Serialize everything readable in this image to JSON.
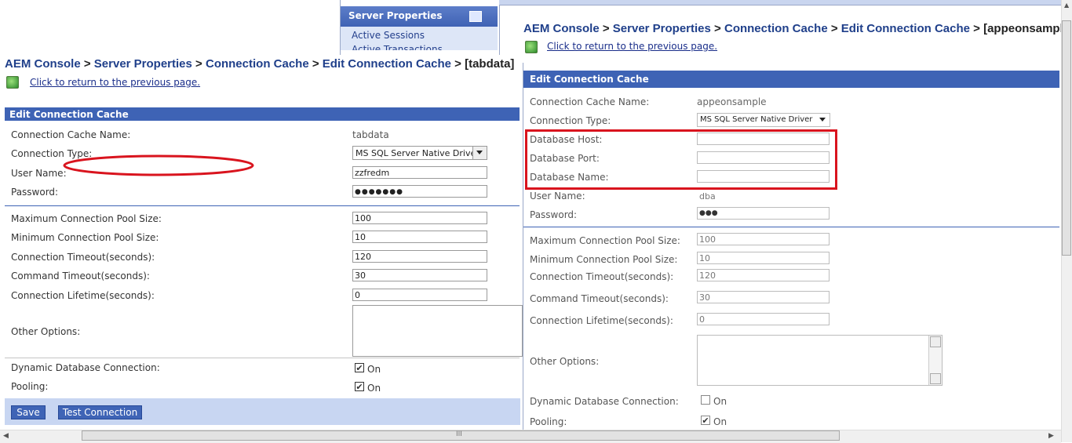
{
  "sidebar": {
    "title": "Server Properties",
    "items": [
      "Active Sessions",
      "Active Transactions"
    ]
  },
  "left": {
    "breadcrumb": [
      "AEM Console",
      "Server Properties",
      "Connection Cache",
      "Edit Connection Cache"
    ],
    "breadcrumb_sep": ">",
    "breadcrumb_current": "[tabdata]",
    "back_link": "Click to return to the previous page.",
    "section_title": "Edit Connection Cache",
    "labels": {
      "cache_name": "Connection Cache Name:",
      "conn_type": "Connection Type:",
      "user": "User Name:",
      "password": "Password:",
      "max_pool": "Maximum Connection Pool Size:",
      "min_pool": "Minimum Connection Pool Size:",
      "conn_timeout": "Connection Timeout(seconds):",
      "cmd_timeout": "Command Timeout(seconds):",
      "lifetime": "Connection Lifetime(seconds):",
      "other": "Other Options:",
      "dynamic": "Dynamic Database Connection:",
      "pooling": "Pooling:"
    },
    "values": {
      "cache_name": "tabdata",
      "conn_type": "MS SQL Server Native Driver",
      "user": "zzfredm",
      "password": "●●●●●●●",
      "max_pool": "100",
      "min_pool": "10",
      "conn_timeout": "120",
      "cmd_timeout": "30",
      "lifetime": "0",
      "dynamic_on": "On",
      "pooling_on": "On"
    },
    "buttons": {
      "save": "Save",
      "test": "Test Connection"
    },
    "annotation_color": "#d9141e"
  },
  "right": {
    "breadcrumb": [
      "AEM Console",
      "Server Properties",
      "Connection Cache",
      "Edit Connection Cache"
    ],
    "breadcrumb_sep": ">",
    "breadcrumb_current": "[appeonsample]",
    "back_link": "Click to return to the previous page.",
    "section_title": "Edit Connection Cache",
    "labels": {
      "cache_name": "Connection Cache Name:",
      "conn_type": "Connection Type:",
      "db_host": "Database Host:",
      "db_port": "Database Port:",
      "db_name": "Database Name:",
      "user": "User Name:",
      "password": "Password:",
      "max_pool": "Maximum Connection Pool Size:",
      "min_pool": "Minimum Connection Pool Size:",
      "conn_timeout": "Connection Timeout(seconds):",
      "cmd_timeout": "Command Timeout(seconds):",
      "lifetime": "Connection Lifetime(seconds):",
      "other": "Other Options:",
      "dynamic": "Dynamic Database Connection:",
      "pooling": "Pooling:"
    },
    "values": {
      "cache_name": "appeonsample",
      "conn_type": "MS SQL Server Native Driver",
      "db_host": "",
      "db_port": "",
      "db_name": "",
      "user": "dba",
      "password": "●●●",
      "max_pool": "100",
      "min_pool": "10",
      "conn_timeout": "120",
      "cmd_timeout": "30",
      "lifetime": "0",
      "dynamic_on": "On",
      "pooling_on": "On"
    },
    "annotation_color": "#d9141e"
  },
  "scrollbar": {
    "grip": "III"
  }
}
